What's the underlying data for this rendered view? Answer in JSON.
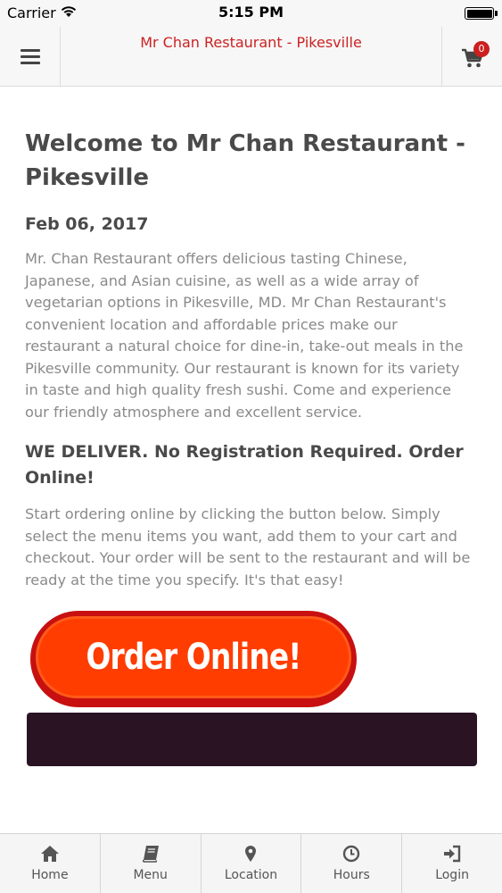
{
  "status_bar": {
    "carrier": "Carrier",
    "time": "5:15 PM"
  },
  "header": {
    "title": "Mr Chan Restaurant - Pikesville",
    "title_color": "#cc2222",
    "cart_count": "0",
    "menu_icon": "hamburger-icon",
    "cart_icon": "cart-icon"
  },
  "article": {
    "title": "Welcome to Mr Chan Restaurant - Pikesville",
    "date": "Feb 06, 2017",
    "intro": "Mr. Chan Restaurant offers delicious tasting Chinese, Japanese, and Asian cuisine, as well as a wide array of vegetarian options in Pikesville, MD.   Mr Chan Restaurant's convenient location and affordable prices make our restaurant a natural choice for dine-in, take-out meals in the Pikesville community. Our restaurant is known for its variety in taste and high quality fresh sushi. Come and experience our friendly atmosphere and excellent service.",
    "subheading": "WE DELIVER. No Registration Required. Order Online!",
    "instructions": "Start ordering online by clicking the button below. Simply select the menu items you want, add them to your cart and checkout. Your order will be sent to the restaurant and will be ready at the time you specify. It's that easy!",
    "order_button_label": "Order Online!"
  },
  "tab_bar": {
    "tabs": [
      {
        "label": "Home",
        "icon": "home-icon"
      },
      {
        "label": "Menu",
        "icon": "book-icon"
      },
      {
        "label": "Location",
        "icon": "map-pin-icon"
      },
      {
        "label": "Hours",
        "icon": "clock-icon"
      },
      {
        "label": "Login",
        "icon": "login-icon"
      }
    ]
  }
}
